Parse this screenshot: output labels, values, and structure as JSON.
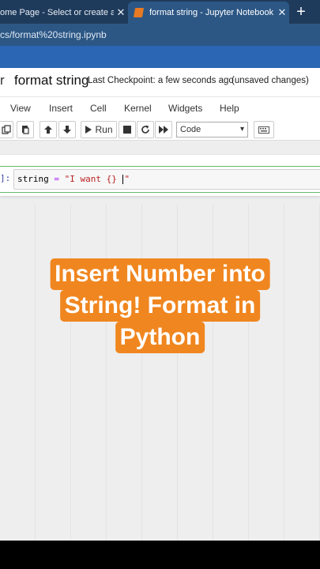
{
  "browser": {
    "tabs": [
      {
        "title": "ome Page - Select or create a n",
        "active": false
      },
      {
        "title": "format string - Jupyter Notebook",
        "active": true
      }
    ],
    "close_glyph": "✕",
    "new_tab_glyph": "+",
    "address": "cs/format%20string.ipynb"
  },
  "jupyter": {
    "logo_fragment": "r",
    "notebook_name": "format string",
    "checkpoint": "Last Checkpoint: a few seconds ago",
    "unsaved": "(unsaved changes)",
    "menu": [
      "View",
      "Insert",
      "Cell",
      "Kernel",
      "Widgets",
      "Help"
    ],
    "toolbar": {
      "run_label": "Run",
      "cell_type": "Code"
    },
    "cell": {
      "prompt": "]:",
      "code_var": "string",
      "code_op": " = ",
      "code_str": "\"I want {} \""
    }
  },
  "overlay": {
    "lines": [
      "Insert Number into",
      "String! Format in",
      "Python"
    ]
  },
  "colors": {
    "tabstrip": "#1f3b5c",
    "active_tab": "#2c5785",
    "caption_bg": "#f0861f",
    "cell_border": "#66bb6a"
  }
}
